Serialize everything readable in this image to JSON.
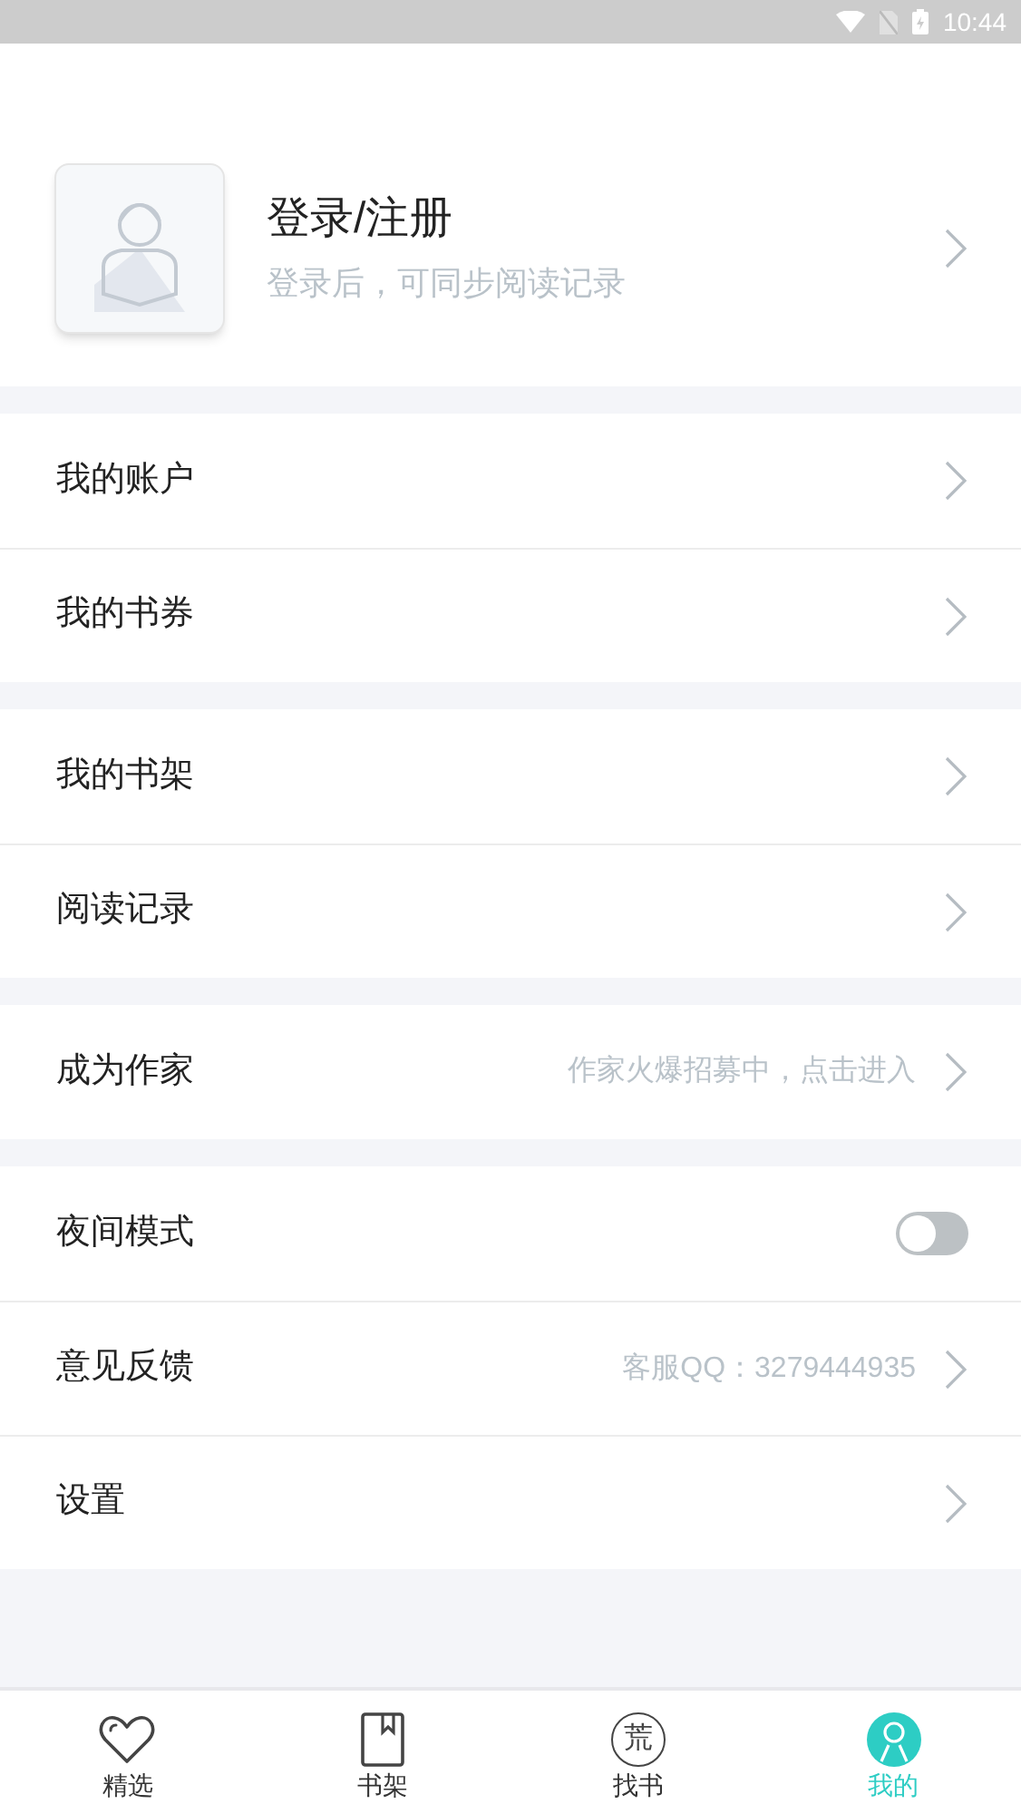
{
  "status_bar": {
    "time": "10:44"
  },
  "profile": {
    "title": "登录/注册",
    "subtitle": "登录后，可同步阅读记录"
  },
  "groups": [
    {
      "rows": [
        {
          "kind": "link",
          "label": "我的账户"
        },
        {
          "kind": "link",
          "label": "我的书券"
        }
      ]
    },
    {
      "rows": [
        {
          "kind": "link",
          "label": "我的书架"
        },
        {
          "kind": "link",
          "label": "阅读记录"
        }
      ]
    },
    {
      "rows": [
        {
          "kind": "link",
          "label": "成为作家",
          "hint": "作家火爆招募中，点击进入"
        }
      ]
    },
    {
      "rows": [
        {
          "kind": "toggle",
          "label": "夜间模式",
          "on": false
        },
        {
          "kind": "link",
          "label": "意见反馈",
          "hint": "客服QQ：3279444935"
        },
        {
          "kind": "link",
          "label": "设置"
        }
      ]
    }
  ],
  "nav": [
    {
      "kind": "heart",
      "label": "精选",
      "selected": false
    },
    {
      "kind": "book",
      "label": "书架",
      "selected": false
    },
    {
      "kind": "glyph",
      "glyph": "荒",
      "label": "找书",
      "selected": false
    },
    {
      "kind": "person",
      "label": "我的",
      "selected": true
    }
  ]
}
